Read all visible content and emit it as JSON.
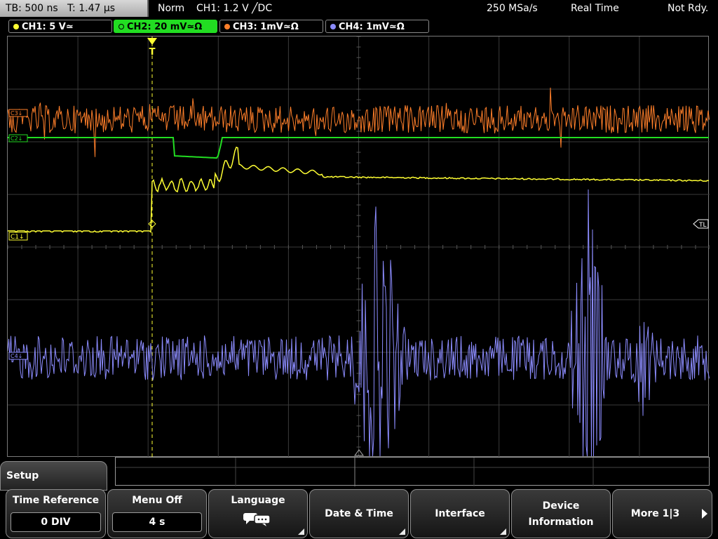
{
  "top_bar": {
    "timebase": "TB: 500 ns",
    "trigger_time": "T: 1.47 µs",
    "trigger_mode": "Norm",
    "trigger_source": "CH1: 1.2 V ╱DC",
    "sample_rate": "250 MSa/s",
    "acq_mode": "Real Time",
    "status": "Not Rdy."
  },
  "channels": [
    {
      "label": "CH1: 5 V≃",
      "color": "#ffff33",
      "active": false
    },
    {
      "label": "CH2: 20 mV≃Ω",
      "color": "#22dd22",
      "active": true
    },
    {
      "label": "CH3: 1mV≃Ω",
      "color": "#ff7f2a",
      "active": false
    },
    {
      "label": "CH4: 1mV≃Ω",
      "color": "#8c8cff",
      "active": false
    }
  ],
  "markers": {
    "ch1": "C1↓",
    "ch2": "C2↓",
    "ch3": "C3↓",
    "ch4": "C4↓",
    "trigger_level": "TL",
    "trigger_pos": "T"
  },
  "menu": {
    "setup_label": "Setup",
    "keys": [
      {
        "title": "Time Reference",
        "value": "0 DIV"
      },
      {
        "title": "Menu Off",
        "value": "4 s"
      },
      {
        "title": "Language",
        "icon": "speech-bubbles-icon"
      },
      {
        "title": "Date & Time"
      },
      {
        "title": "Interface"
      },
      {
        "title": "Device",
        "title2": "Information"
      },
      {
        "title": "More 1|3"
      }
    ]
  },
  "colors": {
    "ch1": "#ffff33",
    "ch2": "#22dd22",
    "ch3": "#ff7f2a",
    "ch4": "#8c8cff",
    "grid": "#3a3a3a"
  }
}
